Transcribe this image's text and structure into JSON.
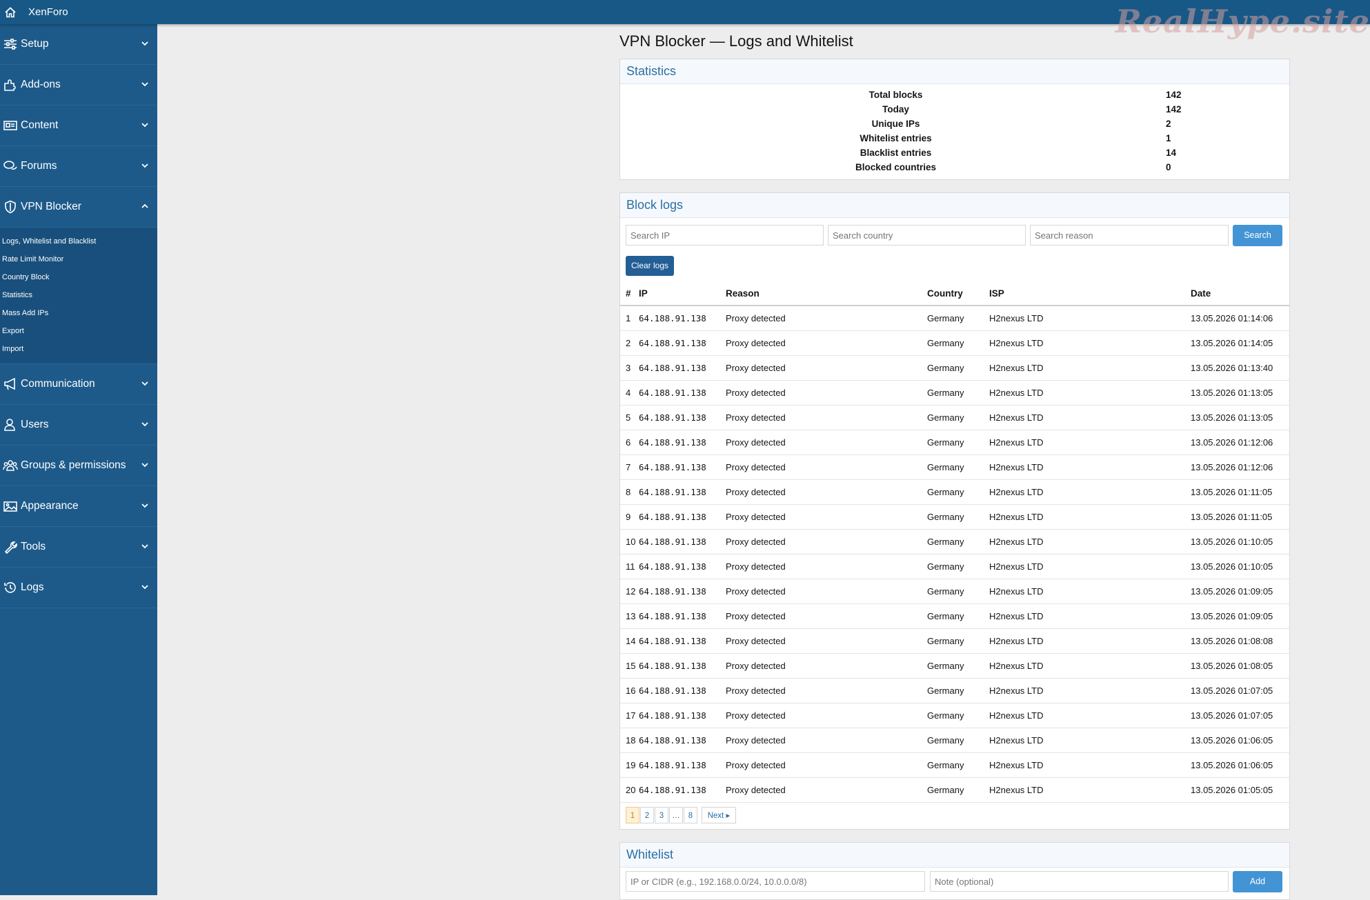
{
  "topbar": {
    "brand": "XenForo",
    "watermark": "RealHype.site"
  },
  "sidebar": {
    "items": [
      {
        "label": "Setup",
        "icon": "sliders-icon"
      },
      {
        "label": "Add-ons",
        "icon": "puzzle-icon"
      },
      {
        "label": "Content",
        "icon": "newspaper-icon"
      },
      {
        "label": "Forums",
        "icon": "comments-icon"
      },
      {
        "label": "VPN Blocker",
        "icon": "shield-icon"
      },
      {
        "label": "Communication",
        "icon": "megaphone-icon"
      },
      {
        "label": "Users",
        "icon": "user-icon"
      },
      {
        "label": "Groups & permissions",
        "icon": "users-icon"
      },
      {
        "label": "Appearance",
        "icon": "image-icon"
      },
      {
        "label": "Tools",
        "icon": "wrench-icon"
      },
      {
        "label": "Logs",
        "icon": "history-icon"
      }
    ],
    "sub_items": [
      "Logs, Whitelist and Blacklist",
      "Rate Limit Monitor",
      "Country Block",
      "Statistics",
      "Mass Add IPs",
      "Export",
      "Import"
    ]
  },
  "page": {
    "title": "VPN Blocker — Logs and Whitelist"
  },
  "statistics": {
    "heading": "Statistics",
    "rows": [
      {
        "label": "Total blocks",
        "value": "142"
      },
      {
        "label": "Today",
        "value": "142"
      },
      {
        "label": "Unique IPs",
        "value": "2"
      },
      {
        "label": "Whitelist entries",
        "value": "1"
      },
      {
        "label": "Blacklist entries",
        "value": "14"
      },
      {
        "label": "Blocked countries",
        "value": "0"
      }
    ]
  },
  "block_logs": {
    "heading": "Block logs",
    "search_ip_placeholder": "Search IP",
    "search_country_placeholder": "Search country",
    "search_reason_placeholder": "Search reason",
    "search_button": "Search",
    "clear_button": "Clear logs",
    "columns": [
      "#",
      "IP",
      "Reason",
      "Country",
      "ISP",
      "Date"
    ],
    "rows": [
      [
        "1",
        "64.188.91.138",
        "Proxy detected",
        "Germany",
        "H2nexus LTD",
        "13.05.2026 01:14:06"
      ],
      [
        "2",
        "64.188.91.138",
        "Proxy detected",
        "Germany",
        "H2nexus LTD",
        "13.05.2026 01:14:05"
      ],
      [
        "3",
        "64.188.91.138",
        "Proxy detected",
        "Germany",
        "H2nexus LTD",
        "13.05.2026 01:13:40"
      ],
      [
        "4",
        "64.188.91.138",
        "Proxy detected",
        "Germany",
        "H2nexus LTD",
        "13.05.2026 01:13:05"
      ],
      [
        "5",
        "64.188.91.138",
        "Proxy detected",
        "Germany",
        "H2nexus LTD",
        "13.05.2026 01:13:05"
      ],
      [
        "6",
        "64.188.91.138",
        "Proxy detected",
        "Germany",
        "H2nexus LTD",
        "13.05.2026 01:12:06"
      ],
      [
        "7",
        "64.188.91.138",
        "Proxy detected",
        "Germany",
        "H2nexus LTD",
        "13.05.2026 01:12:06"
      ],
      [
        "8",
        "64.188.91.138",
        "Proxy detected",
        "Germany",
        "H2nexus LTD",
        "13.05.2026 01:11:05"
      ],
      [
        "9",
        "64.188.91.138",
        "Proxy detected",
        "Germany",
        "H2nexus LTD",
        "13.05.2026 01:11:05"
      ],
      [
        "10",
        "64.188.91.138",
        "Proxy detected",
        "Germany",
        "H2nexus LTD",
        "13.05.2026 01:10:05"
      ],
      [
        "11",
        "64.188.91.138",
        "Proxy detected",
        "Germany",
        "H2nexus LTD",
        "13.05.2026 01:10:05"
      ],
      [
        "12",
        "64.188.91.138",
        "Proxy detected",
        "Germany",
        "H2nexus LTD",
        "13.05.2026 01:09:05"
      ],
      [
        "13",
        "64.188.91.138",
        "Proxy detected",
        "Germany",
        "H2nexus LTD",
        "13.05.2026 01:09:05"
      ],
      [
        "14",
        "64.188.91.138",
        "Proxy detected",
        "Germany",
        "H2nexus LTD",
        "13.05.2026 01:08:08"
      ],
      [
        "15",
        "64.188.91.138",
        "Proxy detected",
        "Germany",
        "H2nexus LTD",
        "13.05.2026 01:08:05"
      ],
      [
        "16",
        "64.188.91.138",
        "Proxy detected",
        "Germany",
        "H2nexus LTD",
        "13.05.2026 01:07:05"
      ],
      [
        "17",
        "64.188.91.138",
        "Proxy detected",
        "Germany",
        "H2nexus LTD",
        "13.05.2026 01:07:05"
      ],
      [
        "18",
        "64.188.91.138",
        "Proxy detected",
        "Germany",
        "H2nexus LTD",
        "13.05.2026 01:06:05"
      ],
      [
        "19",
        "64.188.91.138",
        "Proxy detected",
        "Germany",
        "H2nexus LTD",
        "13.05.2026 01:06:05"
      ],
      [
        "20",
        "64.188.91.138",
        "Proxy detected",
        "Germany",
        "H2nexus LTD",
        "13.05.2026 01:05:05"
      ]
    ],
    "pagination": {
      "pages": [
        "1",
        "2",
        "3",
        "…",
        "8"
      ],
      "current": "1",
      "next": "Next ▸"
    }
  },
  "whitelist": {
    "heading": "Whitelist",
    "ip_placeholder": "IP or CIDR (e.g., 192.168.0.0/24, 10.0.0.0/8)",
    "note_placeholder": "Note (optional)",
    "add_button": "Add"
  }
}
